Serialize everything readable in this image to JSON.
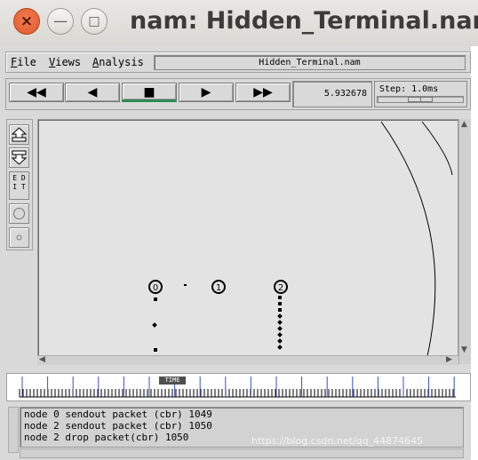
{
  "window": {
    "title": "nam: Hidden_Terminal.nam",
    "close_glyph": "×",
    "minimize_glyph": "—",
    "maximize_glyph": "□"
  },
  "menu": {
    "items": [
      {
        "label": "File",
        "accel": "F",
        "rest": "ile"
      },
      {
        "label": "Views",
        "accel": "V",
        "rest": "iews"
      },
      {
        "label": "Analysis",
        "accel": "A",
        "rest": "nalysis"
      }
    ],
    "filename": "Hidden_Terminal.nam"
  },
  "playback": {
    "buttons": [
      {
        "name": "fast-rewind-button",
        "glyph": "◀◀"
      },
      {
        "name": "rewind-button",
        "glyph": "◀"
      },
      {
        "name": "stop-button",
        "glyph": "■"
      },
      {
        "name": "play-button",
        "glyph": "▶"
      },
      {
        "name": "fast-forward-button",
        "glyph": "▶▶"
      }
    ],
    "active_button": "stop-button",
    "time": "5.932678",
    "step_label": "Step: 1.0ms"
  },
  "toolbar": {
    "edit_label": "ED\nIT"
  },
  "nodes": [
    {
      "id": "0",
      "label": "0"
    },
    {
      "id": "1",
      "label": "1"
    },
    {
      "id": "2",
      "label": "2"
    }
  ],
  "timeline": {
    "marker_label": "TIME"
  },
  "log": {
    "lines": [
      "node 0 sendout packet (cbr) 1049",
      "node 2 sendout packet (cbr) 1050",
      "node 2 drop packet(cbr) 1050"
    ]
  },
  "watermark": "https://blog.csdn.net/qq_44874645",
  "colors": {
    "accent_active": "#2e8b57",
    "timeline_tick_major": "#3a4fbf",
    "close_button": "#e05a2c"
  }
}
